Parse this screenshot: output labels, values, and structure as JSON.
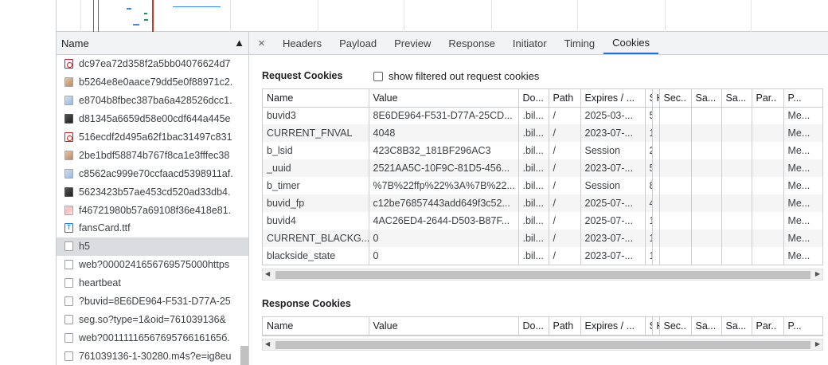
{
  "request_list": {
    "header": "Name",
    "items": [
      {
        "name": "dc97ea72d358f2a5bb04076624d7",
        "icon": "red-image-icon"
      },
      {
        "name": "b5264e8e0aace79dd5e0f88971c2.",
        "icon": "image-icon"
      },
      {
        "name": "e8704b8fbec387ba6a428526dcc1.",
        "icon": "image-icon"
      },
      {
        "name": "d81345a6659d58e00cdf644a445e",
        "icon": "image-icon"
      },
      {
        "name": "516ecdf2d495a62f1bac31497c831",
        "icon": "red-image-icon"
      },
      {
        "name": "2be1bdf58874b767f8ca1e3fffec38",
        "icon": "image-icon"
      },
      {
        "name": "c8562ac999e70ccfaacd5398911af.",
        "icon": "image-icon"
      },
      {
        "name": "5623423b57ae453cd520ad33db4.",
        "icon": "image-icon"
      },
      {
        "name": "f46721980b57a69108f36e418e81.",
        "icon": "image-icon"
      },
      {
        "name": "fansCard.ttf",
        "icon": "font-icon"
      },
      {
        "name": "h5",
        "icon": "document-icon"
      },
      {
        "name": "web?0000241656769575000https",
        "icon": "document-icon"
      },
      {
        "name": "heartbeat",
        "icon": "document-icon"
      },
      {
        "name": "?buvid=8E6DE964-F531-D77A-25",
        "icon": "document-icon"
      },
      {
        "name": "seg.so?type=1&oid=761039136&",
        "icon": "document-icon"
      },
      {
        "name": "web?0011111656769576616165б.",
        "icon": "document-icon"
      },
      {
        "name": "761039136-1-30280.m4s?e=ig8eu",
        "icon": "document-icon"
      }
    ]
  },
  "tabs": {
    "close": "×",
    "items": [
      "Headers",
      "Payload",
      "Preview",
      "Response",
      "Initiator",
      "Timing",
      "Cookies"
    ],
    "active": "Cookies"
  },
  "request_cookies": {
    "title": "Request Cookies",
    "filter_label": "show filtered out request cookies",
    "columns": [
      "Name",
      "Value",
      "Do...",
      "Path",
      "Expires / ...",
      "S",
      "H",
      "Sec..",
      "Sa...",
      "Sa...",
      "Par..",
      "P..."
    ],
    "rows": [
      [
        "buvid3",
        "8E6DE964-F531-D77A-25CD...",
        ".bil...",
        "/",
        "2025-03-...",
        "5.",
        "",
        "",
        "",
        "",
        "",
        "Me..."
      ],
      [
        "CURRENT_FNVAL",
        "4048",
        ".bil...",
        "/",
        "2023-07-...",
        "1.",
        "",
        "",
        "",
        "",
        "",
        "Me..."
      ],
      [
        "b_lsid",
        "423C8B32_181BF296AC3",
        ".bil...",
        "/",
        "Session",
        "2.",
        "",
        "",
        "",
        "",
        "",
        "Me..."
      ],
      [
        "_uuid",
        "2521AA5C-10F9C-81D5-456...",
        ".bil...",
        "/",
        "2023-07-...",
        "5.",
        "",
        "",
        "",
        "",
        "",
        "Me..."
      ],
      [
        "b_timer",
        "%7B%22ffp%22%3A%7B%22...",
        ".bil...",
        "/",
        "Session",
        "8.",
        "",
        "",
        "",
        "",
        "",
        "Me..."
      ],
      [
        "buvid_fp",
        "c12be76857443add649f3c52...",
        ".bil...",
        "/",
        "2025-07-...",
        "4.",
        "",
        "",
        "",
        "",
        "",
        "Me..."
      ],
      [
        "buvid4",
        "4AC26ED4-2644-D503-B87F...",
        ".bil...",
        "/",
        "2025-07-...",
        "1.",
        "",
        "",
        "",
        "",
        "",
        "Me..."
      ],
      [
        "CURRENT_BLACKG...",
        "0",
        ".bil...",
        "/",
        "2023-07-...",
        "1.",
        "",
        "",
        "",
        "",
        "",
        "Me..."
      ],
      [
        "blackside_state",
        "0",
        ".bil...",
        "/",
        "2023-07-...",
        "1.",
        "",
        "",
        "",
        "",
        "",
        "Me..."
      ]
    ]
  },
  "response_cookies": {
    "title": "Response Cookies",
    "columns": [
      "Name",
      "Value",
      "Do...",
      "Path",
      "Expires / ...",
      "S",
      "H",
      "Sec..",
      "Sa...",
      "Sa...",
      "Par..",
      "P..."
    ]
  }
}
